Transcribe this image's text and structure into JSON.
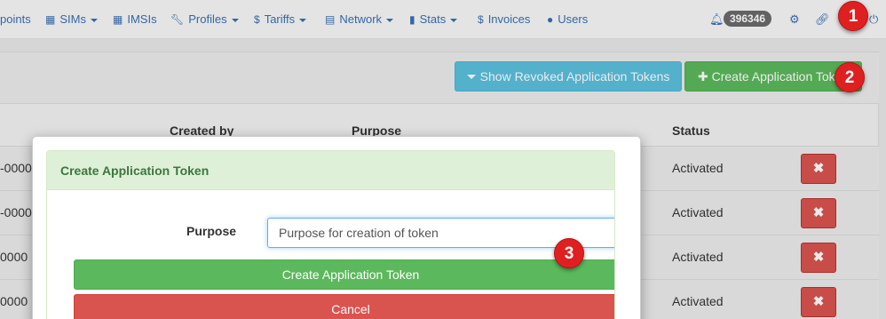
{
  "navbar": {
    "items": [
      {
        "label": "points",
        "icon": ""
      },
      {
        "label": "SIMs",
        "icon": "sims-grid-icon",
        "dropdown": true
      },
      {
        "label": "IMSIs",
        "icon": "imsis-grid-icon"
      },
      {
        "label": "Profiles",
        "icon": "wrench-icon",
        "dropdown": true
      },
      {
        "label": "Tariffs",
        "icon": "dollar-icon",
        "dropdown": true
      },
      {
        "label": "Network",
        "icon": "network-icon",
        "dropdown": true
      },
      {
        "label": "Stats",
        "icon": "bar-chart-icon",
        "dropdown": true
      },
      {
        "label": "Invoices",
        "icon": "dollar-icon"
      },
      {
        "label": "Users",
        "icon": "user-icon"
      }
    ],
    "notification_count": "396346"
  },
  "toolbar": {
    "show_revoked_label": "Show Revoked Application Tokens",
    "create_label": "Create Application Token"
  },
  "table": {
    "headers": {
      "created_by": "Created by",
      "purpose": "Purpose",
      "status": "Status"
    },
    "rows": [
      {
        "id": "-0000",
        "status": "Activated"
      },
      {
        "id": "-0000",
        "status": "Activated"
      },
      {
        "id": "0000",
        "status": "Activated"
      },
      {
        "id": "0000",
        "status": "Activated"
      }
    ]
  },
  "modal": {
    "title": "Create Application Token",
    "purpose_label": "Purpose",
    "purpose_value": "Purpose for creation of token",
    "create_button": "Create Application Token",
    "cancel_button": "Cancel"
  },
  "steps": [
    "1",
    "2",
    "3"
  ],
  "colors": {
    "link": "#3a6fb0",
    "info": "#5bc0de",
    "success": "#5cb85c",
    "danger": "#d9534f",
    "marker": "#e02020"
  }
}
